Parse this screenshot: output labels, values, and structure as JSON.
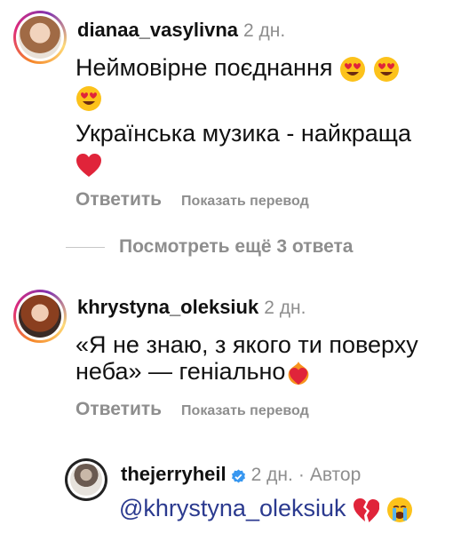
{
  "comments": [
    {
      "username": "dianaa_vasylivna",
      "time": "2 дн.",
      "line1": "Неймовірне поєднання",
      "line3": "Українська музика - найкраща",
      "reply_label": "Ответить",
      "translate_label": "Показать перевод"
    },
    {
      "username": "khrystyna_oleksiuk",
      "time": "2 дн.",
      "line1": "«Я не знаю, з якого ти поверху",
      "line2": "неба» — геніально",
      "reply_label": "Ответить",
      "translate_label": "Показать перевод"
    }
  ],
  "more_replies_label": "Посмотреть ещё 3 ответа",
  "reply": {
    "username": "thejerryheil",
    "time": "2 дн.",
    "separator": "·",
    "author_label": "Автор",
    "mention": "@khrystyna_oleksiuk"
  },
  "colors": {
    "muted": "#8e8e8e",
    "mention": "#2b3a8f",
    "verified": "#3797f0",
    "heart": "#e0243a"
  }
}
